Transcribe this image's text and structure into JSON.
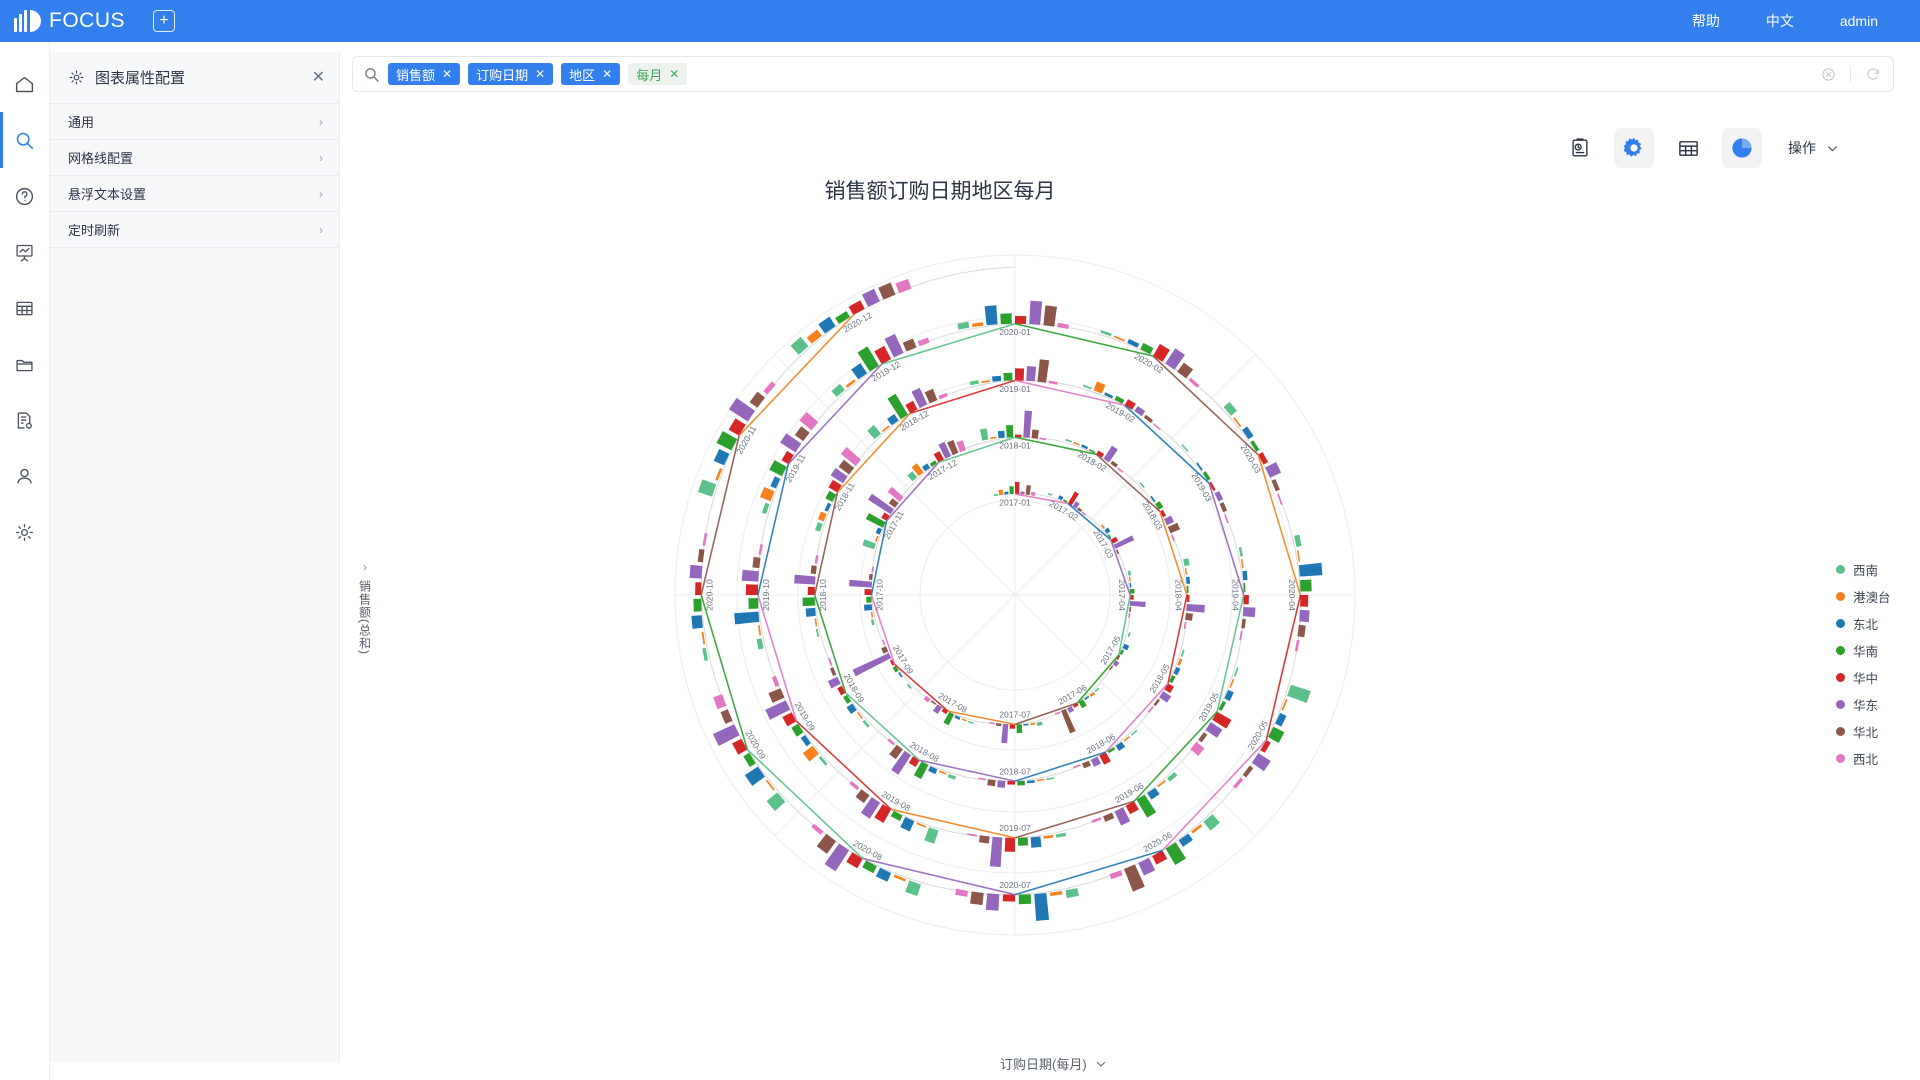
{
  "header": {
    "brand": "FOCUS",
    "add_tab_icon": "plus-square-icon",
    "help": "帮助",
    "language": "中文",
    "user": "admin",
    "accent": "#337FEE"
  },
  "rail": {
    "items": [
      {
        "name": "home",
        "icon": "home-icon",
        "active": false
      },
      {
        "name": "search",
        "icon": "search-icon",
        "active": true
      },
      {
        "name": "help",
        "icon": "question-circle-icon",
        "active": false
      },
      {
        "name": "dashboard",
        "icon": "presentation-chart-icon",
        "active": false
      },
      {
        "name": "table",
        "icon": "table-icon",
        "active": false
      },
      {
        "name": "folder",
        "icon": "folder-icon",
        "active": false
      },
      {
        "name": "doc-settings",
        "icon": "document-gear-icon",
        "active": false
      },
      {
        "name": "user",
        "icon": "user-icon",
        "active": false
      },
      {
        "name": "settings",
        "icon": "gear-icon",
        "active": false
      }
    ]
  },
  "panel": {
    "icon": "gear-icon",
    "title": "图表属性配置",
    "close_icon": "close-icon",
    "rows": [
      {
        "label": "通用"
      },
      {
        "label": "网格线配置"
      },
      {
        "label": "悬浮文本设置"
      },
      {
        "label": "定时刷新"
      }
    ],
    "chevron": "›"
  },
  "search": {
    "icon": "search-icon",
    "placeholder": "",
    "chips": [
      {
        "label": "销售额",
        "type": "blue"
      },
      {
        "label": "订购日期",
        "type": "blue"
      },
      {
        "label": "地区",
        "type": "blue"
      },
      {
        "label": "每月",
        "type": "green"
      }
    ],
    "clear_icon": "clear-circle-icon",
    "refresh_icon": "refresh-icon"
  },
  "toolbar": {
    "buttons": [
      {
        "name": "history-icon",
        "active": false
      },
      {
        "name": "gear-icon",
        "active": true
      },
      {
        "name": "table-icon",
        "active": false
      },
      {
        "name": "pie-chart-icon",
        "active": true
      }
    ],
    "operation_label": "操作",
    "operation_chevron": "⌄"
  },
  "chart_data": {
    "type": "bar",
    "title": "销售额订购日期地区每月",
    "xlabel": "订购日期(每月)",
    "ylabel": "销售额(总和)",
    "layout": "polar-spiral",
    "grid": true,
    "legend_position": "right",
    "legend": [
      {
        "name": "西南",
        "color": "#5cc08a"
      },
      {
        "name": "港澳台",
        "color": "#f5821f"
      },
      {
        "name": "东北",
        "color": "#1f77b4"
      },
      {
        "name": "华南",
        "color": "#2ca02c"
      },
      {
        "name": "华中",
        "color": "#d62728"
      },
      {
        "name": "华东",
        "color": "#9467bd"
      },
      {
        "name": "华北",
        "color": "#8c564b"
      },
      {
        "name": "西北",
        "color": "#e377c2"
      }
    ],
    "series": [
      {
        "name": "西南",
        "color": "#5cc08a"
      },
      {
        "name": "港澳台",
        "color": "#f5821f"
      },
      {
        "name": "东北",
        "color": "#1f77b4"
      },
      {
        "name": "华南",
        "color": "#2ca02c"
      },
      {
        "name": "华中",
        "color": "#d62728"
      },
      {
        "name": "华东",
        "color": "#9467bd"
      },
      {
        "name": "华北",
        "color": "#8c564b"
      },
      {
        "name": "西北",
        "color": "#e377c2"
      }
    ],
    "categories": [
      "2017-01",
      "2017-02",
      "2017-03",
      "2017-04",
      "2017-05",
      "2017-06",
      "2017-07",
      "2017-08",
      "2017-09",
      "2017-10",
      "2017-11",
      "2017-12",
      "2018-01",
      "2018-02",
      "2018-03",
      "2018-04",
      "2018-05",
      "2018-06",
      "2018-07",
      "2018-08",
      "2018-09",
      "2018-10",
      "2018-11",
      "2018-12",
      "2019-01",
      "2019-02",
      "2019-03",
      "2019-04",
      "2019-05",
      "2019-06",
      "2019-07",
      "2019-08",
      "2019-09",
      "2019-10",
      "2019-11",
      "2019-12",
      "2020-01",
      "2020-02",
      "2020-03",
      "2020-04",
      "2020-05",
      "2020-06",
      "2020-07",
      "2020-08",
      "2020-09",
      "2020-10",
      "2020-11",
      "2020-12"
    ],
    "values": [
      [
        2,
        6,
        3,
        9,
        14,
        3,
        11,
        4
      ],
      [
        1,
        0,
        4,
        2,
        16,
        7,
        3,
        1
      ],
      [
        0,
        2,
        5,
        1,
        7,
        24,
        2,
        0
      ],
      [
        3,
        1,
        1,
        5,
        4,
        18,
        2,
        1
      ],
      [
        2,
        0,
        6,
        3,
        2,
        5,
        1,
        0
      ],
      [
        1,
        3,
        2,
        8,
        3,
        6,
        28,
        2
      ],
      [
        4,
        2,
        1,
        10,
        5,
        22,
        3,
        1
      ],
      [
        1,
        1,
        3,
        14,
        4,
        9,
        2,
        5
      ],
      [
        2,
        0,
        2,
        4,
        3,
        46,
        6,
        1
      ],
      [
        3,
        1,
        9,
        6,
        8,
        26,
        4,
        2
      ],
      [
        14,
        2,
        5,
        22,
        7,
        31,
        9,
        18
      ],
      [
        9,
        13,
        6,
        4,
        11,
        18,
        16,
        12
      ],
      [
        13,
        2,
        8,
        14,
        3,
        31,
        10,
        2
      ],
      [
        2,
        1,
        3,
        1,
        5,
        18,
        4,
        1
      ],
      [
        1,
        0,
        2,
        6,
        4,
        9,
        12,
        1
      ],
      [
        6,
        1,
        4,
        2,
        3,
        21,
        8,
        1
      ],
      [
        2,
        3,
        5,
        4,
        8,
        11,
        3,
        2
      ],
      [
        1,
        1,
        7,
        3,
        12,
        9,
        6,
        1
      ],
      [
        2,
        1,
        3,
        5,
        4,
        8,
        7,
        1
      ],
      [
        4,
        2,
        6,
        18,
        9,
        27,
        14,
        3
      ],
      [
        3,
        1,
        8,
        5,
        6,
        12,
        4,
        2
      ],
      [
        2,
        1,
        11,
        14,
        8,
        24,
        6,
        3
      ],
      [
        6,
        7,
        4,
        9,
        12,
        17,
        15,
        22
      ],
      [
        13,
        2,
        9,
        28,
        11,
        21,
        14,
        4
      ],
      [
        4,
        2,
        6,
        9,
        14,
        17,
        26,
        3
      ],
      [
        2,
        11,
        3,
        5,
        8,
        7,
        4,
        1
      ],
      [
        1,
        0,
        2,
        4,
        3,
        6,
        5,
        1
      ],
      [
        3,
        1,
        5,
        2,
        6,
        14,
        4,
        2
      ],
      [
        2,
        1,
        7,
        4,
        19,
        16,
        5,
        12
      ],
      [
        5,
        2,
        9,
        24,
        11,
        18,
        7,
        3
      ],
      [
        4,
        3,
        12,
        9,
        16,
        34,
        8,
        2
      ],
      [
        16,
        2,
        13,
        7,
        18,
        22,
        11,
        4
      ],
      [
        3,
        14,
        6,
        9,
        12,
        26,
        15,
        5
      ],
      [
        6,
        2,
        28,
        11,
        14,
        19,
        8,
        3
      ],
      [
        5,
        13,
        7,
        16,
        9,
        21,
        12,
        18
      ],
      [
        9,
        3,
        14,
        26,
        17,
        24,
        11,
        6
      ],
      [
        7,
        4,
        22,
        12,
        9,
        27,
        23,
        5
      ],
      [
        3,
        2,
        5,
        8,
        16,
        21,
        13,
        4
      ],
      [
        9,
        2,
        7,
        4,
        6,
        14,
        5,
        2
      ],
      [
        6,
        1,
        26,
        13,
        9,
        11,
        8,
        3
      ],
      [
        24,
        2,
        8,
        14,
        6,
        17,
        5,
        4
      ],
      [
        13,
        3,
        9,
        22,
        11,
        16,
        28,
        6
      ],
      [
        9,
        4,
        31,
        11,
        8,
        19,
        14,
        7
      ],
      [
        14,
        3,
        11,
        9,
        13,
        29,
        18,
        5
      ],
      [
        16,
        2,
        18,
        8,
        12,
        27,
        9,
        11
      ],
      [
        4,
        2,
        12,
        9,
        7,
        14,
        6,
        3
      ],
      [
        17,
        3,
        13,
        19,
        14,
        26,
        11,
        6
      ],
      [
        14,
        9,
        13,
        8,
        11,
        16,
        15,
        12
      ]
    ],
    "rings": [
      "2017",
      "2018",
      "2019",
      "2020"
    ]
  }
}
